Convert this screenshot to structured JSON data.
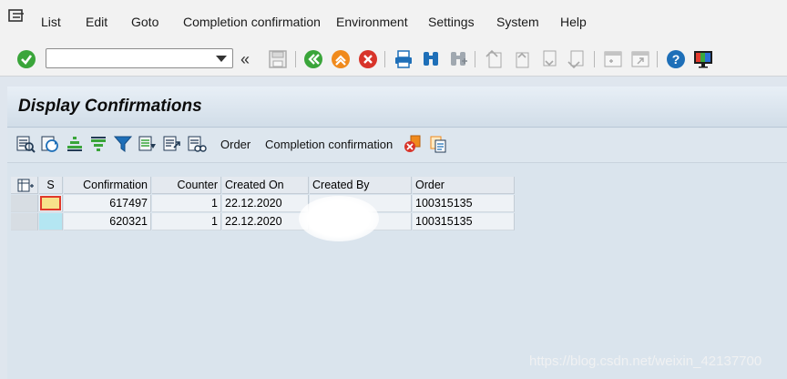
{
  "menubar": {
    "items": [
      "List",
      "Edit",
      "Goto",
      "Completion confirmation",
      "Environment",
      "Settings",
      "System",
      "Help"
    ]
  },
  "toolbar": {
    "command_field_value": "",
    "icons": [
      "check-icon",
      "back-chevrons-icon",
      "save-icon",
      "back-icon",
      "exit-icon",
      "cancel-icon",
      "print-icon",
      "find-icon",
      "find-next-icon",
      "first-page-icon",
      "previous-page-icon",
      "next-page-icon",
      "last-page-icon",
      "new-session-icon",
      "shortcut-icon",
      "help-icon",
      "customize-layout-icon"
    ]
  },
  "page": {
    "title": "Display Confirmations"
  },
  "app_toolbar": {
    "order_label": "Order",
    "completion_label": "Completion confirmation"
  },
  "table": {
    "columns": [
      "S",
      "Confirmation",
      "Counter",
      "Created On",
      "Created By",
      "Order"
    ],
    "rows": [
      {
        "status": "",
        "confirmation": "617497",
        "counter": "1",
        "created_on": "22.12.2020",
        "created_by": "",
        "order": "100315135"
      },
      {
        "status": "",
        "confirmation": "620321",
        "counter": "1",
        "created_on": "22.12.2020",
        "created_by": "",
        "order": "100315135"
      }
    ]
  },
  "watermark": "https://blog.csdn.net/weixin_42137700",
  "colors": {
    "accent_green": "#3aa53a",
    "accent_orange": "#f08a1c",
    "accent_red": "#d8342a",
    "accent_blue": "#1e6fb8",
    "status_yellow": "#f7e28a",
    "status_cyan": "#b4e6f2"
  }
}
